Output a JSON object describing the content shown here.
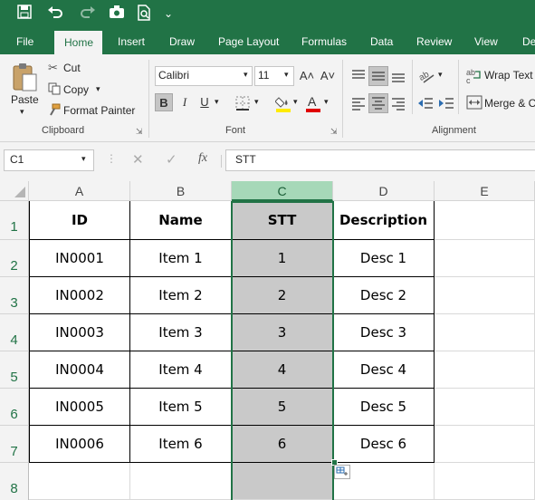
{
  "quick_access": {
    "more": "⌄"
  },
  "tabs": [
    {
      "label": "File"
    },
    {
      "label": "Home"
    },
    {
      "label": "Insert"
    },
    {
      "label": "Draw"
    },
    {
      "label": "Page Layout"
    },
    {
      "label": "Formulas"
    },
    {
      "label": "Data"
    },
    {
      "label": "Review"
    },
    {
      "label": "View"
    },
    {
      "label": "De"
    }
  ],
  "clipboard": {
    "paste": "Paste",
    "cut": "Cut",
    "copy": "Copy",
    "format_painter": "Format Painter",
    "group": "Clipboard"
  },
  "font": {
    "name": "Calibri",
    "size": "11",
    "bold": "B",
    "italic": "I",
    "underline": "U",
    "group": "Font",
    "increase": "A˄",
    "decrease": "A˅"
  },
  "alignment": {
    "wrap_text": "Wrap Text",
    "merge": "Merge & C",
    "group": "Alignment"
  },
  "formula_bar": {
    "name_box": "C1",
    "fx": "fx",
    "value": "STT"
  },
  "columns": [
    "A",
    "B",
    "C",
    "D",
    "E"
  ],
  "rows": [
    "1",
    "2",
    "3",
    "4",
    "5",
    "6",
    "7",
    "8"
  ],
  "table": {
    "headers": [
      "ID",
      "Name",
      "STT",
      "Description"
    ],
    "rows": [
      [
        "IN0001",
        "Item 1",
        "1",
        "Desc 1"
      ],
      [
        "IN0002",
        "Item 2",
        "2",
        "Desc 2"
      ],
      [
        "IN0003",
        "Item 3",
        "3",
        "Desc 3"
      ],
      [
        "IN0004",
        "Item 4",
        "4",
        "Desc 4"
      ],
      [
        "IN0005",
        "Item 5",
        "5",
        "Desc 5"
      ],
      [
        "IN0006",
        "Item 6",
        "6",
        "Desc 6"
      ]
    ]
  },
  "colors": {
    "accent": "#217346",
    "selection": "#c9c9c9",
    "header_selected": "#a6d8b8"
  }
}
